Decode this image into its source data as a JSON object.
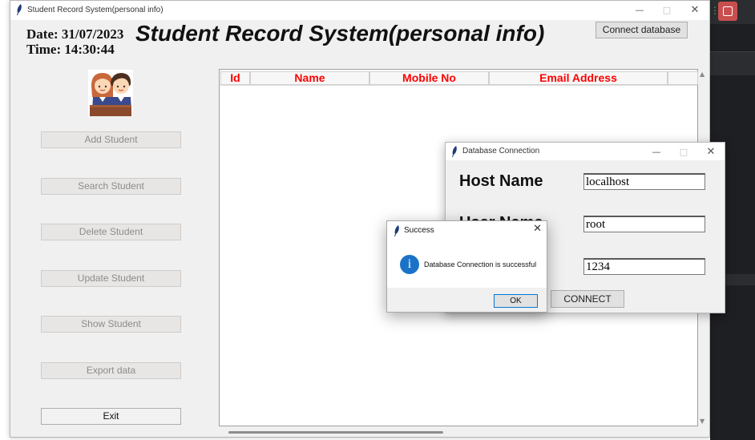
{
  "main_window": {
    "title": "Student Record System(personal info)",
    "minimize": "—",
    "maximize": "□",
    "close": "✕"
  },
  "header": {
    "date": "Date: 31/07/2023",
    "time": "Time: 14:30:44",
    "app_title": "Student Record System(personal info)",
    "connect_button": "Connect database"
  },
  "avatar_icon": "students-avatar-icon",
  "sidebar": {
    "buttons": [
      {
        "label": "Add Student",
        "enabled": false
      },
      {
        "label": "Search Student",
        "enabled": false
      },
      {
        "label": "Delete Student",
        "enabled": false
      },
      {
        "label": "Update Student",
        "enabled": false
      },
      {
        "label": "Show Student",
        "enabled": false
      },
      {
        "label": "Export data",
        "enabled": false
      },
      {
        "label": "Exit",
        "enabled": true
      }
    ]
  },
  "table": {
    "columns": [
      "Id",
      "Name",
      "Mobile No",
      "Email Address"
    ],
    "rows": []
  },
  "db_dialog": {
    "title": "Database Connection",
    "host_label": "Host Name",
    "host_value": "localhost",
    "user_label": "User Name",
    "user_value": "root",
    "password_value": "1234",
    "connect_button": "CONNECT"
  },
  "success_dialog": {
    "title": "Success",
    "close": "✕",
    "icon": "info-icon",
    "message": "Database Connection is successful",
    "ok_button": "OK"
  },
  "colors": {
    "column_header_text": "#ff0000",
    "info_icon": "#1a73c8",
    "ide_stop": "#c94f4f"
  }
}
